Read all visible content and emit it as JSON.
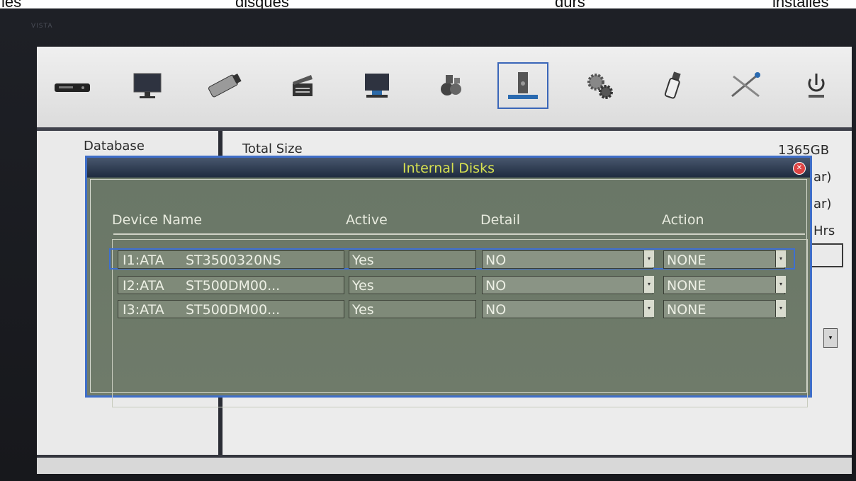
{
  "caption": {
    "words": [
      "les",
      "disques",
      "durs",
      "installés"
    ]
  },
  "bezel": {
    "brand": "VISTA"
  },
  "toolbar": {
    "icons": [
      "dvr-icon",
      "monitor-icon",
      "camera-icon",
      "clapper-icon",
      "display-icon",
      "capture-icon",
      "disk-icon",
      "gears-icon",
      "usb-icon",
      "tools-icon",
      "power-icon"
    ],
    "active_index": 6
  },
  "sidebar": {
    "label": "Database"
  },
  "background": {
    "total_size_label": "Total Size",
    "total_size_value": "1365GB",
    "side_snippets": [
      "ar)",
      "ar)",
      "Hrs"
    ]
  },
  "dialog": {
    "title": "Internal Disks",
    "columns": [
      "Device Name",
      "Active",
      "Detail",
      "Action"
    ],
    "rows": [
      {
        "device": "I1:ATA     ST3500320NS",
        "active": "Yes",
        "detail": "NO",
        "action": "NONE",
        "selected": true
      },
      {
        "device": "I2:ATA     ST500DM00...",
        "active": "Yes",
        "detail": "NO",
        "action": "NONE",
        "selected": false
      },
      {
        "device": "I3:ATA     ST500DM00...",
        "active": "Yes",
        "detail": "NO",
        "action": "NONE",
        "selected": false
      }
    ]
  },
  "colors": {
    "accent": "#3e6fd2",
    "dialog_bg": "#707c6b",
    "title_text": "#d6e050"
  }
}
